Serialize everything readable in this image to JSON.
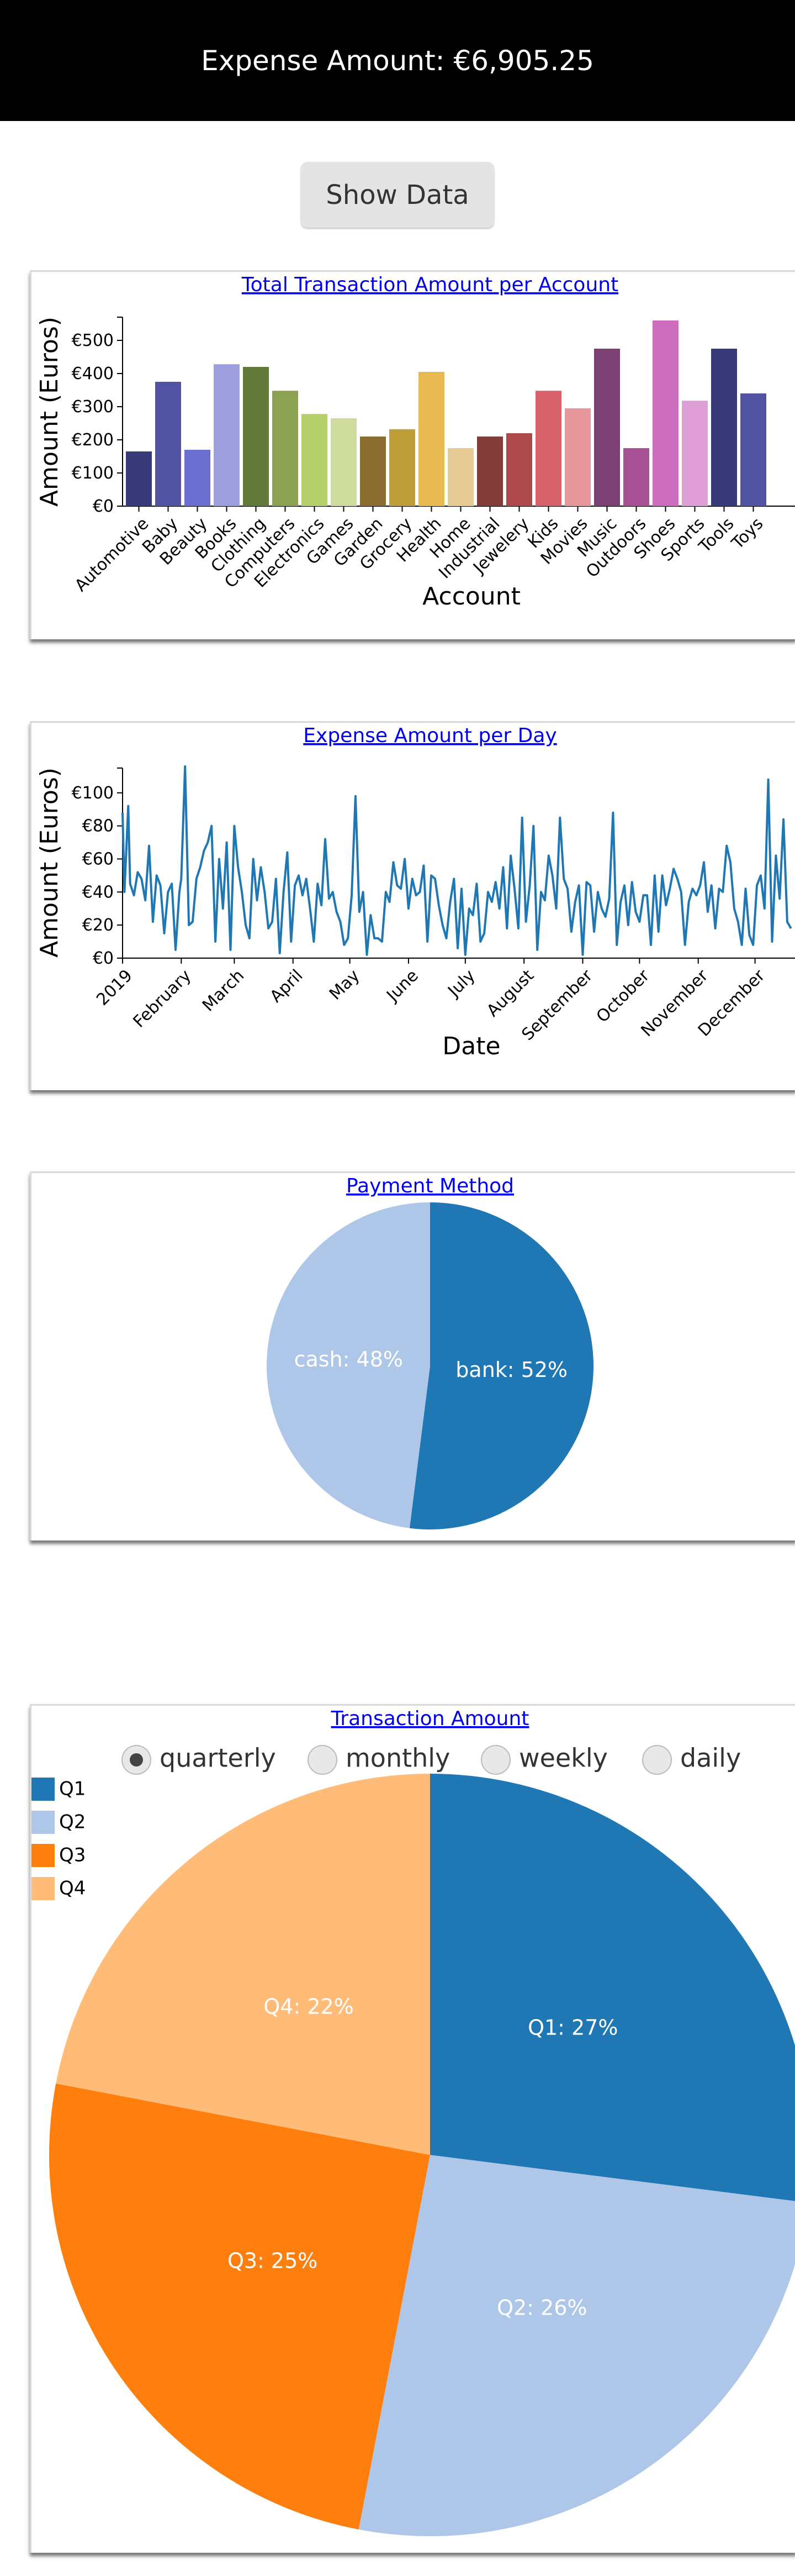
{
  "header": {
    "expense_label": "Expense Amount: €6,905.25"
  },
  "toolbar": {
    "show_data_label": "Show Data"
  },
  "colors": {
    "blue": "#1f77b4",
    "light_blue": "#aec7e8",
    "orange": "#ff7f0e",
    "light_orange": "#ffbb78",
    "link": "#0000ee"
  },
  "charts": [
    {
      "title": "Total Transaction Amount per Account",
      "chart_data": {
        "type": "bar",
        "title": "Total Transaction Amount per Account",
        "xlabel": "Account",
        "ylabel": "Amount (Euros)",
        "ylim": [
          0,
          570
        ],
        "y_ticks": [
          "€0",
          "€100",
          "€200",
          "€300",
          "€400",
          "€500"
        ],
        "categories": [
          "Automotive",
          "Baby",
          "Beauty",
          "Books",
          "Clothing",
          "Computers",
          "Electronics",
          "Games",
          "Garden",
          "Grocery",
          "Health",
          "Home",
          "Industrial",
          "Jewelery",
          "Kids",
          "Movies",
          "Music",
          "Outdoors",
          "Shoes",
          "Sports",
          "Tools",
          "Toys"
        ],
        "values": [
          165,
          375,
          170,
          428,
          420,
          348,
          278,
          265,
          210,
          232,
          405,
          175,
          210,
          220,
          348,
          295,
          475,
          175,
          560,
          318,
          475,
          340
        ],
        "colors": [
          "#393b79",
          "#5254a3",
          "#6b6ecf",
          "#9c9ede",
          "#637939",
          "#8ca252",
          "#b5cf6b",
          "#cedb9c",
          "#8c6d31",
          "#bd9e39",
          "#e7ba52",
          "#e7cb94",
          "#843c39",
          "#ad494a",
          "#d6616b",
          "#e7969c",
          "#7b4173",
          "#a55194",
          "#ce6dbd",
          "#de9ed6",
          "#393b79",
          "#5254a3"
        ]
      }
    },
    {
      "title": "Expense Amount per Day",
      "chart_data": {
        "type": "line",
        "title": "Expense Amount per Day",
        "xlabel": "Date",
        "ylabel": "Amount (Euros)",
        "ylim": [
          0,
          115
        ],
        "y_ticks": [
          "€0",
          "€20",
          "€40",
          "€60",
          "€80",
          "€100"
        ],
        "x_ticks": [
          "2019",
          "February",
          "March",
          "April",
          "May",
          "June",
          "July",
          "August",
          "September",
          "October",
          "November",
          "December"
        ],
        "x": [
          "2019-01-01",
          "2019-01-02",
          "2019-01-04",
          "2019-01-05",
          "2019-01-07",
          "2019-01-09",
          "2019-01-11",
          "2019-01-13",
          "2019-01-15",
          "2019-01-17",
          "2019-01-19",
          "2019-01-21",
          "2019-01-23",
          "2019-01-25",
          "2019-01-27",
          "2019-01-29",
          "2019-01-31",
          "2019-02-01",
          "2019-02-03",
          "2019-02-05",
          "2019-02-07",
          "2019-02-09",
          "2019-02-11",
          "2019-02-13",
          "2019-02-15",
          "2019-02-17",
          "2019-02-19",
          "2019-02-21",
          "2019-02-23",
          "2019-02-25",
          "2019-02-27",
          "2019-03-01",
          "2019-03-03",
          "2019-03-05",
          "2019-03-07",
          "2019-03-09",
          "2019-03-11",
          "2019-03-13",
          "2019-03-15",
          "2019-03-17",
          "2019-03-19",
          "2019-03-21",
          "2019-03-23",
          "2019-03-25",
          "2019-03-27",
          "2019-03-29",
          "2019-03-31",
          "2019-04-02",
          "2019-04-04",
          "2019-04-06",
          "2019-04-08",
          "2019-04-10",
          "2019-04-12",
          "2019-04-14",
          "2019-04-16",
          "2019-04-18",
          "2019-04-20",
          "2019-04-22",
          "2019-04-24",
          "2019-04-26",
          "2019-04-28",
          "2019-04-30",
          "2019-05-02",
          "2019-05-04",
          "2019-05-06",
          "2019-05-08",
          "2019-05-10",
          "2019-05-12",
          "2019-05-14",
          "2019-05-16",
          "2019-05-18",
          "2019-05-20",
          "2019-05-22",
          "2019-05-24",
          "2019-05-26",
          "2019-05-28",
          "2019-05-30",
          "2019-06-01",
          "2019-06-03",
          "2019-06-05",
          "2019-06-07",
          "2019-06-09",
          "2019-06-11",
          "2019-06-13",
          "2019-06-15",
          "2019-06-17",
          "2019-06-19",
          "2019-06-21",
          "2019-06-23",
          "2019-06-25",
          "2019-06-27",
          "2019-06-29",
          "2019-07-01",
          "2019-07-03",
          "2019-07-05",
          "2019-07-07",
          "2019-07-09",
          "2019-07-11",
          "2019-07-13",
          "2019-07-15",
          "2019-07-17",
          "2019-07-19",
          "2019-07-21",
          "2019-07-23",
          "2019-07-25",
          "2019-07-27",
          "2019-07-29",
          "2019-07-31",
          "2019-08-02",
          "2019-08-04",
          "2019-08-06",
          "2019-08-08",
          "2019-08-10",
          "2019-08-12",
          "2019-08-14",
          "2019-08-16",
          "2019-08-18",
          "2019-08-20",
          "2019-08-22",
          "2019-08-24",
          "2019-08-26",
          "2019-08-28",
          "2019-08-30",
          "2019-09-01",
          "2019-09-03",
          "2019-09-05",
          "2019-09-07",
          "2019-09-09",
          "2019-09-11",
          "2019-09-13",
          "2019-09-15",
          "2019-09-17",
          "2019-09-19",
          "2019-09-21",
          "2019-09-23",
          "2019-09-25",
          "2019-09-27",
          "2019-09-29",
          "2019-10-01",
          "2019-10-03",
          "2019-10-05",
          "2019-10-07",
          "2019-10-09",
          "2019-10-11",
          "2019-10-13",
          "2019-10-15",
          "2019-10-17",
          "2019-10-19",
          "2019-10-21",
          "2019-10-23",
          "2019-10-25",
          "2019-10-27",
          "2019-10-29",
          "2019-10-31",
          "2019-11-02",
          "2019-11-04",
          "2019-11-06",
          "2019-11-08",
          "2019-11-10",
          "2019-11-12",
          "2019-11-14",
          "2019-11-16",
          "2019-11-18",
          "2019-11-20",
          "2019-11-22",
          "2019-11-24",
          "2019-11-26",
          "2019-11-28",
          "2019-11-30",
          "2019-12-02",
          "2019-12-04",
          "2019-12-06",
          "2019-12-08",
          "2019-12-10",
          "2019-12-12",
          "2019-12-14",
          "2019-12-16",
          "2019-12-18",
          "2019-12-20"
        ],
        "y": [
          88,
          40,
          92,
          45,
          38,
          52,
          48,
          35,
          68,
          22,
          50,
          44,
          15,
          40,
          45,
          5,
          40,
          48,
          116,
          20,
          22,
          48,
          55,
          65,
          70,
          80,
          10,
          60,
          30,
          70,
          5,
          80,
          55,
          40,
          20,
          12,
          60,
          35,
          55,
          40,
          18,
          22,
          48,
          3,
          40,
          64,
          10,
          44,
          50,
          38,
          48,
          30,
          10,
          45,
          32,
          72,
          36,
          40,
          28,
          22,
          8,
          12,
          38,
          98,
          28,
          40,
          2,
          26,
          12,
          12,
          10,
          40,
          34,
          58,
          44,
          42,
          60,
          30,
          48,
          38,
          40,
          56,
          10,
          50,
          48,
          32,
          20,
          12,
          34,
          48,
          6,
          42,
          2,
          30,
          26,
          45,
          10,
          15,
          40,
          34,
          46,
          30,
          55,
          18,
          62,
          42,
          18,
          85,
          22,
          44,
          80,
          5,
          40,
          35,
          62,
          50,
          30,
          85,
          48,
          42,
          16,
          34,
          44,
          2,
          46,
          44,
          16,
          40,
          30,
          25,
          36,
          88,
          8,
          34,
          44,
          20,
          46,
          28,
          22,
          38,
          38,
          8,
          50,
          16,
          50,
          32,
          42,
          54,
          48,
          40,
          8,
          34,
          42,
          38,
          44,
          58,
          28,
          44,
          18,
          42,
          40,
          68,
          58,
          30,
          22,
          8,
          42,
          14,
          8,
          44,
          50,
          30,
          108,
          10,
          62,
          36,
          84,
          22,
          18,
          28,
          14
        ]
      }
    },
    {
      "title": "Payment Method",
      "chart_data": {
        "type": "pie",
        "title": "Payment Method",
        "categories": [
          "bank",
          "cash"
        ],
        "values": [
          52,
          48
        ],
        "labels": [
          "bank: 52%",
          "cash: 48%"
        ],
        "colors": [
          "#1f77b4",
          "#aec7e8"
        ]
      }
    },
    {
      "title": "Transaction Amount",
      "radio_options": [
        {
          "label": "quarterly",
          "selected": true
        },
        {
          "label": "monthly",
          "selected": false
        },
        {
          "label": "weekly",
          "selected": false
        },
        {
          "label": "daily",
          "selected": false
        }
      ],
      "legend": [
        "Q1",
        "Q2",
        "Q3",
        "Q4"
      ],
      "chart_data": {
        "type": "pie",
        "title": "Transaction Amount",
        "legend_position": "top-left",
        "categories": [
          "Q1",
          "Q2",
          "Q3",
          "Q4"
        ],
        "values": [
          27,
          26,
          25,
          22
        ],
        "labels": [
          "Q1: 27%",
          "Q2: 26%",
          "Q3: 25%",
          "Q4: 22%"
        ],
        "colors": [
          "#1f77b4",
          "#aec7e8",
          "#ff7f0e",
          "#ffbb78"
        ]
      }
    }
  ]
}
